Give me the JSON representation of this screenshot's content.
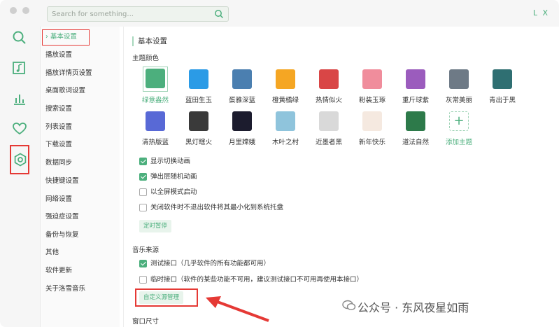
{
  "search": {
    "placeholder": "Search for something..."
  },
  "user_initials": "L X",
  "nav": {
    "items": [
      {
        "label": "基本设置",
        "active": true
      },
      {
        "label": "播放设置"
      },
      {
        "label": "播放详情页设置"
      },
      {
        "label": "桌面歌词设置"
      },
      {
        "label": "搜索设置"
      },
      {
        "label": "列表设置"
      },
      {
        "label": "下载设置"
      },
      {
        "label": "数据同步"
      },
      {
        "label": "快捷键设置"
      },
      {
        "label": "网络设置"
      },
      {
        "label": "强迫症设置"
      },
      {
        "label": "备份与恢复"
      },
      {
        "label": "其他"
      },
      {
        "label": "软件更新"
      },
      {
        "label": "关于洛雪音乐"
      }
    ],
    "active_prefix": "›"
  },
  "content": {
    "section_title": "基本设置",
    "theme_label": "主题颜色",
    "themes": [
      {
        "name": "绿意盎然",
        "color": "#4caf7d",
        "selected": true
      },
      {
        "name": "蓝田生玉",
        "color": "#2b9be6"
      },
      {
        "name": "蛋雅深蓝",
        "color": "#4b7fb0"
      },
      {
        "name": "橙黄橘绿",
        "color": "#f5a623"
      },
      {
        "name": "热情似火",
        "color": "#d94646"
      },
      {
        "name": "粉装玉琢",
        "color": "#f08d9c"
      },
      {
        "name": "重斤球紫",
        "color": "#9b5cbd"
      },
      {
        "name": "灰常美丽",
        "color": "#6e7a86"
      },
      {
        "name": "青出于黑",
        "color": "#2f6f72"
      },
      {
        "name": "清热版蓝",
        "color": "#5869d6"
      },
      {
        "name": "黑灯瞎火",
        "color": "#3a3a3a"
      },
      {
        "name": "月里嫦娥",
        "color": "#1c1c2e"
      },
      {
        "name": "木叶之村",
        "color": "#8fc4dc"
      },
      {
        "name": "近墨者黑",
        "color": "#d9d9d9"
      },
      {
        "name": "新年快乐",
        "color": "#f5e9e0"
      },
      {
        "name": "道法自然",
        "color": "#2d7a4a"
      },
      {
        "name": "添加主题",
        "add": true
      }
    ],
    "add_symbol": "+",
    "checks": [
      {
        "label": "显示切换动画",
        "checked": true
      },
      {
        "label": "弹出层随机动画",
        "checked": true
      },
      {
        "label": "以全屏模式启动",
        "checked": false
      },
      {
        "label": "关闭软件时不退出软件将其最小化到系统托盘",
        "checked": false
      }
    ],
    "timer_button": "定时暂停",
    "music_source_label": "音乐来源",
    "sources": [
      {
        "label": "测试接口（几乎软件的所有功能都可用）",
        "checked": true
      },
      {
        "label": "临时接口（软件的某些功能不可用，建议测试接口不可用再使用本接口）",
        "checked": false
      }
    ],
    "custom_source_button": "自定义源管理",
    "window_size_label": "窗口尺寸"
  },
  "watermark": "公众号 · 东风夜星如雨",
  "colors": {
    "accent": "#4caf7d",
    "highlight": "#e53935"
  }
}
